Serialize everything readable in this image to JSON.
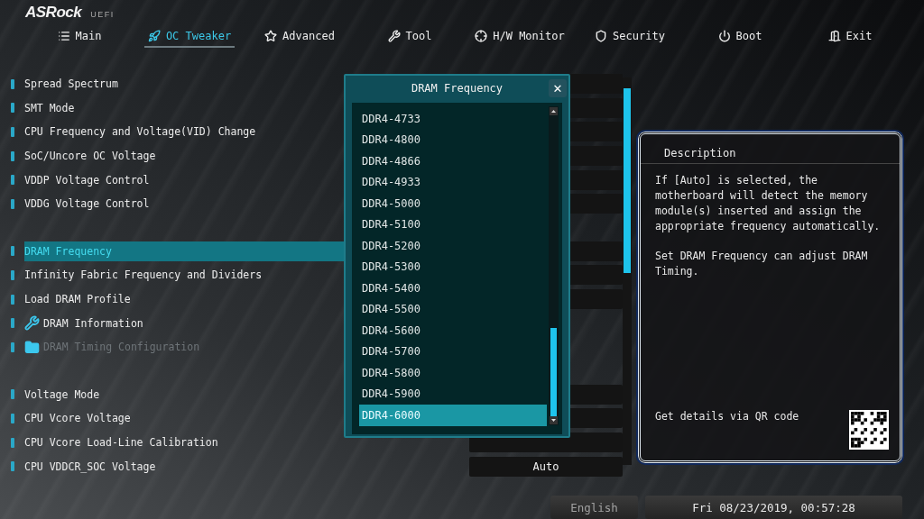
{
  "brand": {
    "logo": "ASRock",
    "suffix": "UEFI"
  },
  "tabs": [
    {
      "label": "Main",
      "kind": "list",
      "selected": false
    },
    {
      "label": "OC Tweaker",
      "kind": "rocket",
      "selected": true
    },
    {
      "label": "Advanced",
      "kind": "star",
      "selected": false
    },
    {
      "label": "Tool",
      "kind": "tool",
      "selected": false
    },
    {
      "label": "H/W Monitor",
      "kind": "monitor",
      "selected": false
    },
    {
      "label": "Security",
      "kind": "shield",
      "selected": false
    },
    {
      "label": "Boot",
      "kind": "power",
      "selected": false
    },
    {
      "label": "Exit",
      "kind": "exit",
      "selected": false
    }
  ],
  "settings": [
    {
      "items": [
        {
          "label": "Spread Spectrum",
          "kind": "option",
          "selected": false,
          "disabled": false
        },
        {
          "label": "SMT Mode",
          "kind": "option",
          "selected": false,
          "disabled": false
        },
        {
          "label": "CPU Frequency and Voltage(VID) Change",
          "kind": "option",
          "selected": false,
          "disabled": false
        },
        {
          "label": "SoC/Uncore OC Voltage",
          "kind": "option",
          "selected": false,
          "disabled": false
        },
        {
          "label": "VDDP Voltage Control",
          "kind": "option",
          "selected": false,
          "disabled": false
        },
        {
          "label": "VDDG Voltage Control",
          "kind": "option",
          "selected": false,
          "disabled": false
        }
      ]
    },
    {
      "items": [
        {
          "label": "DRAM Frequency",
          "kind": "option",
          "selected": true,
          "disabled": false
        },
        {
          "label": "Infinity Fabric Frequency and Dividers",
          "kind": "option",
          "selected": false,
          "disabled": false
        },
        {
          "label": "Load DRAM Profile",
          "kind": "option",
          "selected": false,
          "disabled": false
        },
        {
          "label": "DRAM Information",
          "kind": "tool",
          "selected": false,
          "disabled": false
        },
        {
          "label": "DRAM Timing Configuration",
          "kind": "folder",
          "selected": false,
          "disabled": true
        }
      ]
    },
    {
      "items": [
        {
          "label": "Voltage Mode",
          "kind": "option",
          "selected": false,
          "disabled": false
        },
        {
          "label": "CPU Vcore Voltage",
          "kind": "option",
          "selected": false,
          "disabled": false
        },
        {
          "label": "CPU Vcore Load-Line Calibration",
          "kind": "option",
          "selected": false,
          "disabled": false
        },
        {
          "label": "CPU VDDCR_SOC Voltage",
          "kind": "option",
          "selected": false,
          "disabled": false,
          "value": "Auto"
        }
      ]
    }
  ],
  "popup": {
    "title": "DRAM Frequency",
    "close": "✕",
    "options": [
      {
        "label": "DDR4-4733",
        "selected": false
      },
      {
        "label": "DDR4-4800",
        "selected": false
      },
      {
        "label": "DDR4-4866",
        "selected": false
      },
      {
        "label": "DDR4-4933",
        "selected": false
      },
      {
        "label": "DDR4-5000",
        "selected": false
      },
      {
        "label": "DDR4-5100",
        "selected": false
      },
      {
        "label": "DDR4-5200",
        "selected": false
      },
      {
        "label": "DDR4-5300",
        "selected": false
      },
      {
        "label": "DDR4-5400",
        "selected": false
      },
      {
        "label": "DDR4-5500",
        "selected": false
      },
      {
        "label": "DDR4-5600",
        "selected": false
      },
      {
        "label": "DDR4-5700",
        "selected": false
      },
      {
        "label": "DDR4-5800",
        "selected": false
      },
      {
        "label": "DDR4-5900",
        "selected": false
      },
      {
        "label": "DDR4-6000",
        "selected": true
      }
    ]
  },
  "description": {
    "title": "Description",
    "paragraphs": [
      "If [Auto] is selected, the motherboard will detect the memory module(s) inserted and assign the appropriate frequency automatically.",
      "Set DRAM Frequency can adjust DRAM Timing."
    ],
    "qr_caption": "Get details via QR code"
  },
  "status_bar": {
    "language": "English",
    "datetime": "Fri 08/23/2019, 00:57:28"
  }
}
